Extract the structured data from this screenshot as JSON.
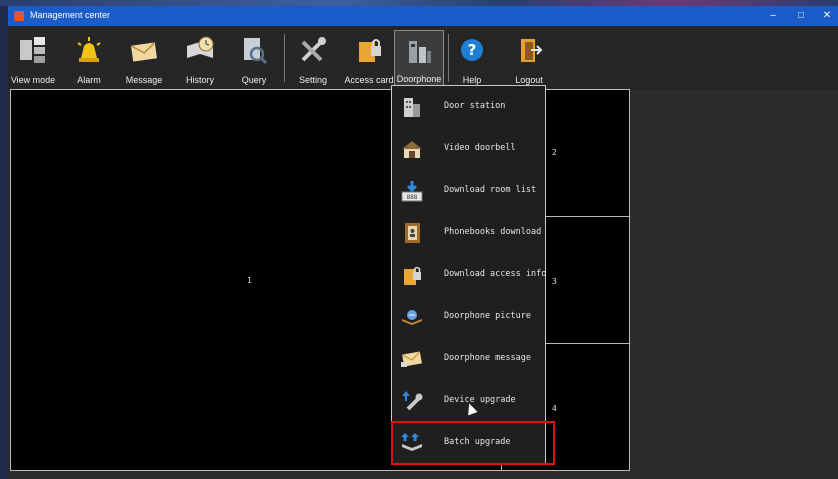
{
  "window": {
    "title": "Management center",
    "minimize": "–",
    "maximize": "□",
    "close": "✕"
  },
  "toolbar": {
    "view_mode": "View mode",
    "alarm": "Alarm",
    "message": "Message",
    "history": "History",
    "query": "Query",
    "setting": "Setting",
    "access_card": "Access card",
    "doorphone": "Doorphone",
    "help": "Help",
    "logout": "Logout"
  },
  "panes": {
    "p1": "1",
    "p2": "2",
    "p3": "3",
    "p4": "4"
  },
  "doorphone_menu": {
    "items": [
      {
        "label": "Door station",
        "icon": "building-icon"
      },
      {
        "label": "Video doorbell",
        "icon": "house-icon"
      },
      {
        "label": "Download room list",
        "icon": "download-list-icon"
      },
      {
        "label": "Phonebooks download",
        "icon": "phonebook-icon"
      },
      {
        "label": "Download access info",
        "icon": "door-lock-icon"
      },
      {
        "label": "Doorphone picture",
        "icon": "picture-icon"
      },
      {
        "label": "Doorphone message",
        "icon": "envelope-icon"
      },
      {
        "label": "Device upgrade",
        "icon": "wrench-upgrade-icon"
      },
      {
        "label": "Batch upgrade",
        "icon": "batch-upgrade-icon"
      }
    ]
  },
  "colors": {
    "titlebar": "#1b5cc8",
    "highlight": "#e01010"
  }
}
